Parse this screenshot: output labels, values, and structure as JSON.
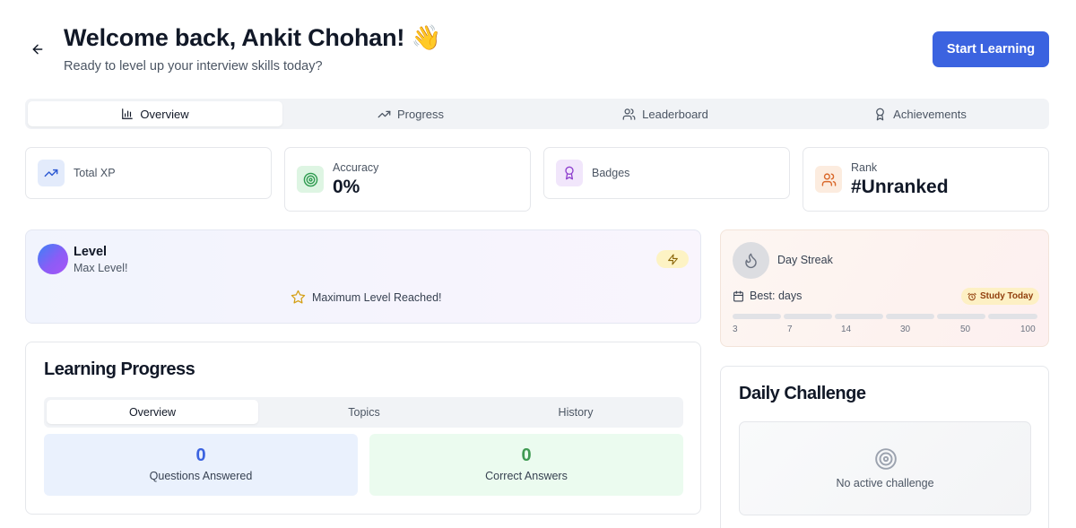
{
  "header": {
    "title": "Welcome back, Ankit Chohan! 👋",
    "subtitle": "Ready to level up your interview skills today?",
    "start_button": "Start Learning"
  },
  "tabs": [
    {
      "label": "Overview",
      "icon": "bar-chart-icon",
      "active": true
    },
    {
      "label": "Progress",
      "icon": "trending-up-icon",
      "active": false
    },
    {
      "label": "Leaderboard",
      "icon": "users-icon",
      "active": false
    },
    {
      "label": "Achievements",
      "icon": "award-icon",
      "active": false
    }
  ],
  "stats": {
    "total_xp": {
      "label": "Total XP",
      "icon": "trending-up-icon"
    },
    "accuracy": {
      "label": "Accuracy",
      "value": "0%",
      "icon": "target-icon"
    },
    "badges": {
      "label": "Badges",
      "icon": "award-icon"
    },
    "rank": {
      "label": "Rank",
      "value": "#Unranked",
      "icon": "users-icon"
    }
  },
  "level": {
    "title": "Level",
    "subtitle": "Max Level!",
    "max_message": "Maximum Level Reached!"
  },
  "streak": {
    "label": "Day Streak",
    "best": "Best: days",
    "badge": "Study Today",
    "milestones": [
      "3",
      "7",
      "14",
      "30",
      "50",
      "100"
    ]
  },
  "learning_progress": {
    "title": "Learning Progress",
    "tabs": [
      "Overview",
      "Topics",
      "History"
    ],
    "questions_answered": {
      "value": "0",
      "label": "Questions Answered"
    },
    "correct_answers": {
      "value": "0",
      "label": "Correct Answers"
    }
  },
  "daily_challenge": {
    "title": "Daily Challenge",
    "empty": "No active challenge"
  },
  "colors": {
    "primary": "#3b63e0",
    "blue_metric": "#3b63e0",
    "green_metric": "#3f9a52"
  }
}
